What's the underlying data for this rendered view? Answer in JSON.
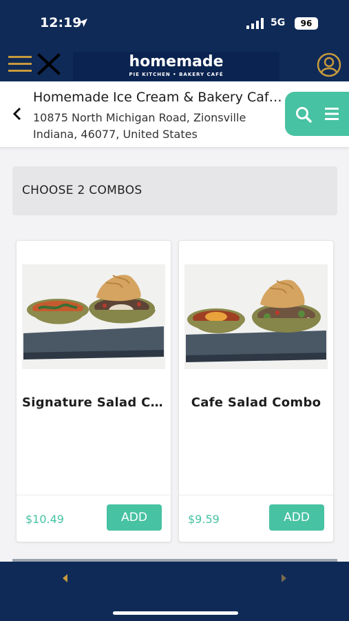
{
  "status_bar": {
    "time": "12:19",
    "network": "5G",
    "battery": "96"
  },
  "app_header": {
    "brand_main": "homemade",
    "brand_sub": "PIE KITCHEN • BAKERY CAFÉ"
  },
  "store": {
    "name": "Homemade Ice Cream & Bakery Café - Zionsville",
    "address_line1": "10875 North Michigan Road, Zionsville",
    "address_line2": "Indiana, 46077, United States"
  },
  "section": {
    "title": "CHOOSE 2 COMBOS"
  },
  "combos": [
    {
      "title": "Signature Salad Combo",
      "price": "$10.49",
      "add_label": "ADD"
    },
    {
      "title": "Cafe Salad Combo",
      "price": "$9.59",
      "add_label": "ADD"
    }
  ],
  "colors": {
    "navy": "#0f2a57",
    "teal": "#47c2a2",
    "gold": "#c79a3c"
  },
  "icons": [
    "location-arrow-icon",
    "signal-icon",
    "menu-icon",
    "close-icon",
    "user-icon",
    "back-icon",
    "search-icon",
    "list-icon",
    "prev-icon",
    "next-icon"
  ]
}
